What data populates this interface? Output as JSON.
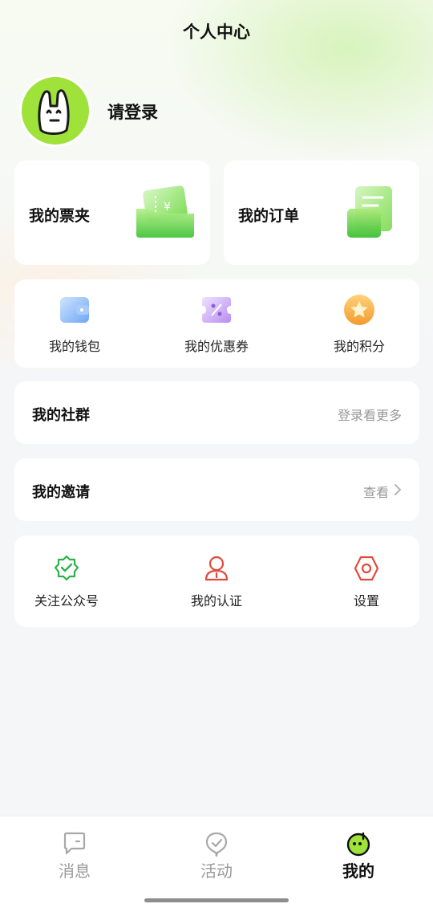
{
  "header": {
    "title": "个人中心"
  },
  "profile": {
    "login_text": "请登录"
  },
  "cards": {
    "tickets": {
      "label": "我的票夹"
    },
    "orders": {
      "label": "我的订单"
    }
  },
  "quick_links": [
    {
      "label": "我的钱包",
      "icon": "wallet-icon"
    },
    {
      "label": "我的优惠券",
      "icon": "coupon-icon"
    },
    {
      "label": "我的积分",
      "icon": "points-star-icon"
    }
  ],
  "community": {
    "title": "我的社群",
    "action": "登录看更多"
  },
  "invite": {
    "title": "我的邀请",
    "action": "查看"
  },
  "services": [
    {
      "label": "关注公众号",
      "icon": "verified-badge-icon"
    },
    {
      "label": "我的认证",
      "icon": "user-verify-icon"
    },
    {
      "label": "设置",
      "icon": "settings-hex-icon"
    }
  ],
  "tabbar": {
    "items": [
      {
        "label": "消息",
        "icon": "message-icon",
        "active": false
      },
      {
        "label": "活动",
        "icon": "activity-icon",
        "active": false
      },
      {
        "label": "我的",
        "icon": "profile-mascot-icon",
        "active": true
      }
    ]
  },
  "colors": {
    "accent": "#9ee23a",
    "text_primary": "#111111",
    "text_muted": "#999999",
    "icon_green": "#2fb14a",
    "icon_red": "#e04a3f",
    "background": "#f5f6f8"
  }
}
